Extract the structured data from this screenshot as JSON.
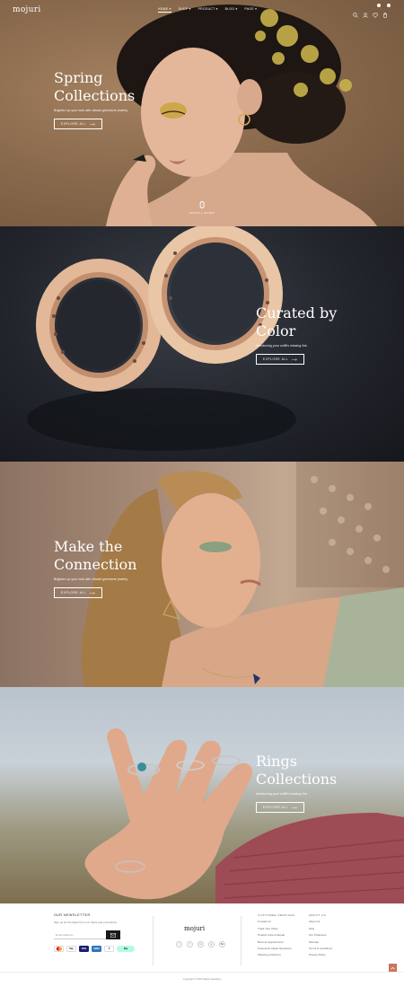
{
  "brand": {
    "logo": "mojuri"
  },
  "nav": {
    "items": [
      {
        "label": "HOME ▾"
      },
      {
        "label": "SHOP ▾"
      },
      {
        "label": "PRODUCT ▾"
      },
      {
        "label": "BLOG ▾"
      },
      {
        "label": "PAGE ▾"
      }
    ]
  },
  "header_icons": [
    "search-icon",
    "user-icon",
    "wishlist-icon",
    "cart-icon"
  ],
  "slides": [
    {
      "title_line1": "Spring",
      "title_line2": "Collections",
      "subtitle": "Brighten up your look with vibrant gemstone jewelry.",
      "button": "EXPLORE ALL",
      "scroll_label": "SCROLL DOWN"
    },
    {
      "title_line1": "Curated by",
      "title_line2": "Color",
      "subtitle": "Introducing your outfit's missing link.",
      "button": "EXPLORE ALL"
    },
    {
      "title_line1": "Make the",
      "title_line2": "Connection",
      "subtitle": "Brighten up your look with vibrant gemstone jewelry.",
      "button": "EXPLORE ALL"
    },
    {
      "title_line1": "Rings",
      "title_line2": "Collections",
      "subtitle": "Introducing your outfit's missing link.",
      "button": "EXPLORE ALL"
    }
  ],
  "footer": {
    "newsletter": {
      "heading": "OUR NEWSLETTER",
      "text": "Sign up for the latest from our chairs and promotions.",
      "placeholder": "Email address..."
    },
    "payments": [
      "MC",
      "Pay",
      "VISA",
      "AMEX",
      "P",
      "Pay"
    ],
    "logo": "mojuri",
    "social": [
      "t",
      "f",
      "in",
      "p",
      "Be"
    ],
    "customer_services": {
      "heading": "CUSTOMER SERVICES",
      "links": [
        "Contact Us",
        "Track Your Order",
        "Product Care & Repair",
        "Book an Appointment",
        "Frequently Asked Questions",
        "Shipping & Returns"
      ]
    },
    "about": {
      "heading": "ABOUT US",
      "links": [
        "About Us",
        "FAQ",
        "Our Producers",
        "Sitemap",
        "Terms & Conditions",
        "Privacy Policy"
      ]
    },
    "copyright": "Copyright © 2022 Mojuri Jewellery"
  },
  "colors": {
    "accent": "#c8755b",
    "dark": "#1a1a1a"
  }
}
